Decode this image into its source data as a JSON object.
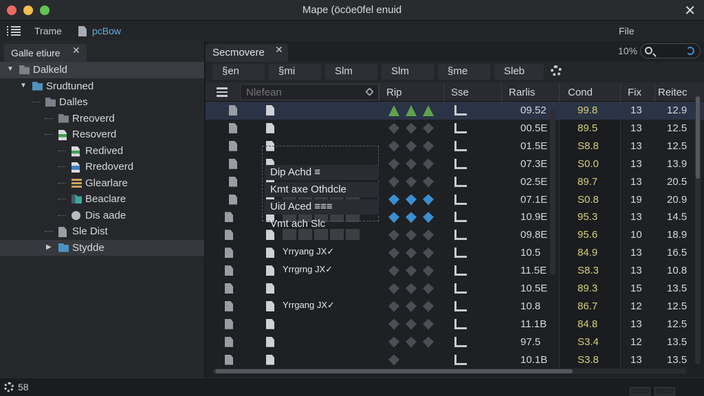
{
  "window": {
    "title": "Mape (öcöe0fel enuid",
    "close_glyph": "✕"
  },
  "toolbar": {
    "label1": "Trame",
    "label2": "pcBow",
    "file": "File"
  },
  "left_panel": {
    "tab": "Galle etiure",
    "close_glyph": "✕",
    "tree": [
      {
        "label": "Dalkeld",
        "indent": 0,
        "caret": "▼",
        "icon": "folder",
        "selected": true
      },
      {
        "label": "Srudtuned",
        "indent": 1,
        "caret": "▼",
        "icon": "folder-blue"
      },
      {
        "label": "Dalles",
        "indent": 2,
        "caret": "",
        "icon": "folder"
      },
      {
        "label": "Rreoverd",
        "indent": 3,
        "caret": "",
        "icon": "folder"
      },
      {
        "label": "Resoverd",
        "indent": 3,
        "caret": "",
        "icon": "doc-green"
      },
      {
        "label": "Redived",
        "indent": 4,
        "caret": "",
        "icon": "doc-green"
      },
      {
        "label": "Rredoverd",
        "indent": 4,
        "caret": "",
        "icon": "doc-blue"
      },
      {
        "label": "Glearlare",
        "indent": 4,
        "caret": "",
        "icon": "stack"
      },
      {
        "label": "Beaclare",
        "indent": 4,
        "caret": "",
        "icon": "stack-teal"
      },
      {
        "label": "Dis aade",
        "indent": 4,
        "caret": "",
        "icon": "gear"
      },
      {
        "label": "Sle Dist",
        "indent": 3,
        "caret": "",
        "icon": "doc-grey"
      },
      {
        "label": "Stydde",
        "indent": 3,
        "caret": "▶",
        "icon": "folder-blue",
        "selected2": true
      }
    ]
  },
  "main": {
    "tab": "Secmovere",
    "close_glyph": "✕",
    "zoom": "10%",
    "search_placeholder": "",
    "filters": [
      "§en",
      "§mi",
      "Slm",
      "Slm",
      "§me",
      "Sleb"
    ],
    "columns": {
      "name_placeholder": "Nlefean",
      "rip": "Rip",
      "see": "Sse",
      "rarts": "Rarlis",
      "cond": "Cond",
      "fix": "Fix",
      "rate": "Reitec"
    },
    "popup_items": [
      "Dip Achd ≡",
      "Kmt axe Othdcle",
      "Uid Aced ≡≡≡",
      "Vmt ach Slc"
    ],
    "chip_texts": [
      "Yrryang JX✓",
      "Yrrgrng JX✓",
      "Yrrgang JX✓"
    ],
    "rows": [
      {
        "size": "09.52",
        "cond": "99.8",
        "fix": "13",
        "rate": "12.9",
        "selected": true
      },
      {
        "size": "00.5E",
        "cond": "89.5",
        "fix": "13",
        "rate": "12.5"
      },
      {
        "size": "01.5E",
        "cond": "S8.8",
        "fix": "13",
        "rate": "12.5"
      },
      {
        "size": "07.3E",
        "cond": "S0.0",
        "fix": "13",
        "rate": "13.9"
      },
      {
        "size": "02.5E",
        "cond": "89.7",
        "fix": "13",
        "rate": "20.5"
      },
      {
        "size": "07.1E",
        "cond": "S0.8",
        "fix": "19",
        "rate": "20.9"
      },
      {
        "size": "10.9E",
        "cond": "95.3",
        "fix": "13",
        "rate": "14.5"
      },
      {
        "size": "09.8E",
        "cond": "95.6",
        "fix": "10",
        "rate": "18.9"
      },
      {
        "size": "10.5",
        "cond": "84.9",
        "fix": "13",
        "rate": "16.5"
      },
      {
        "size": "11.5E",
        "cond": "S8.3",
        "fix": "13",
        "rate": "10.8"
      },
      {
        "size": "10.5E",
        "cond": "89.3",
        "fix": "15",
        "rate": "13.5"
      },
      {
        "size": "10.8",
        "cond": "86.7",
        "fix": "12",
        "rate": "12.5"
      },
      {
        "size": "11.1B",
        "cond": "84.8",
        "fix": "13",
        "rate": "12.5"
      },
      {
        "size": "97.5",
        "cond": "S3.4",
        "fix": "12",
        "rate": "13.5"
      },
      {
        "size": "10.1B",
        "cond": "S3.8",
        "fix": "13",
        "rate": "13.5"
      }
    ]
  },
  "status": {
    "text": "58"
  }
}
